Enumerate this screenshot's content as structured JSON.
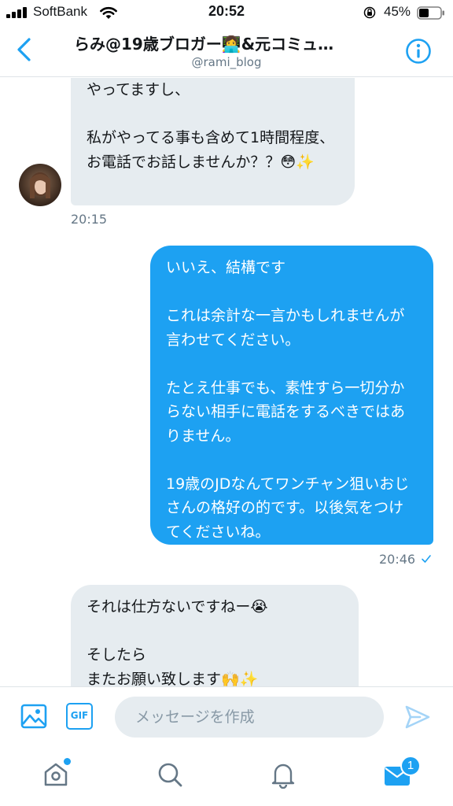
{
  "status_bar": {
    "carrier": "SoftBank",
    "time": "20:52",
    "battery": "45%",
    "icons": [
      "signal-icon",
      "wifi-icon",
      "orientation-lock-icon",
      "battery-icon"
    ]
  },
  "header": {
    "title": "らみ@19歳ブロガー👩‍💻&元コミュ…",
    "handle": "@rami_blog",
    "icons": [
      "back-chevron-icon",
      "info-icon"
    ]
  },
  "messages": [
    {
      "direction": "received",
      "text": "やってますし、\n\n私がやってる事も含めて1時間程度、お電話でお話しませんか？？😳✨",
      "time": "20:15"
    },
    {
      "direction": "sent",
      "text": "いいえ、結構です\n\nこれは余計な一言かもしれませんが言わせてください。\n\nたとえ仕事でも、素性すら一切分からない相手に電話をするべきではありません。\n\n19歳のJDなんてワンチャン狙いおじさんの格好の的です。以後気をつけてくださいね。",
      "time": "20:46",
      "status": "read-check-icon"
    },
    {
      "direction": "received",
      "text": "それは仕方ないですねー😭\n\nそしたら\nまたお願い致します🙌✨"
    }
  ],
  "composer": {
    "placeholder": "メッセージを作成",
    "gif_label": "GIF",
    "icons": [
      "image-icon",
      "gif-icon",
      "send-icon"
    ]
  },
  "tabbar": {
    "icons": [
      "home-icon",
      "search-icon",
      "notifications-icon",
      "messages-icon"
    ],
    "messages_badge": "1"
  },
  "colors": {
    "accent": "#1da1f2",
    "bubble_received": "#e6ecf0",
    "bubble_sent": "#1da1f2",
    "secondary_text": "#657786"
  }
}
